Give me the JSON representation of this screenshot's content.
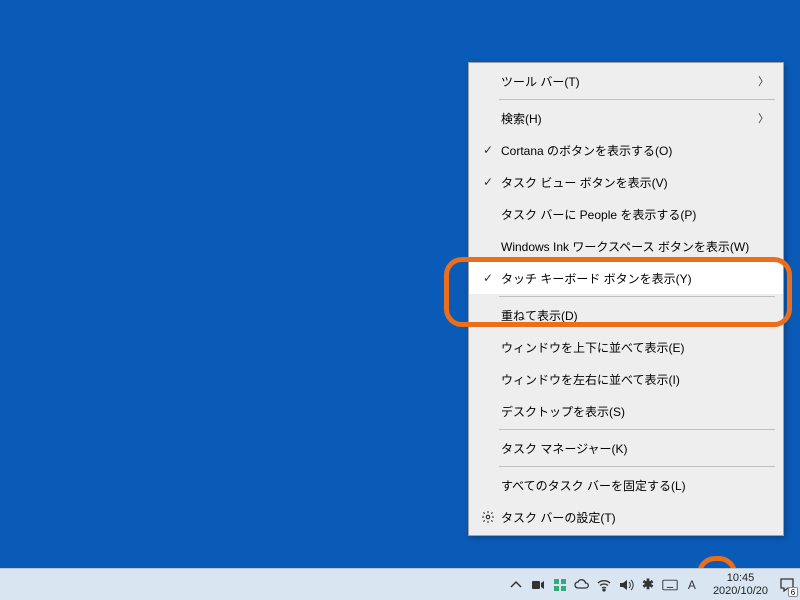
{
  "context_menu": {
    "items": [
      {
        "label": "ツール バー(T)",
        "submenu": true
      },
      {
        "label": "検索(H)",
        "submenu": true
      },
      {
        "label": "Cortana のボタンを表示する(O)",
        "checked": true
      },
      {
        "label": "タスク ビュー ボタンを表示(V)",
        "checked": true
      },
      {
        "label": "タスク バーに People を表示する(P)"
      },
      {
        "label": "Windows Ink ワークスペース ボタンを表示(W)"
      },
      {
        "label": "タッチ キーボード ボタンを表示(Y)",
        "checked": true,
        "highlighted": true
      },
      {
        "label": "重ねて表示(D)"
      },
      {
        "label": "ウィンドウを上下に並べて表示(E)"
      },
      {
        "label": "ウィンドウを左右に並べて表示(I)"
      },
      {
        "label": "デスクトップを表示(S)"
      },
      {
        "label": "タスク マネージャー(K)"
      },
      {
        "label": "すべてのタスク バーを固定する(L)"
      },
      {
        "label": "タスク バーの設定(T)",
        "icon": "gear"
      }
    ]
  },
  "taskbar": {
    "time": "10:45",
    "date": "2020/10/20",
    "ime": "A",
    "notification_count": "6"
  }
}
